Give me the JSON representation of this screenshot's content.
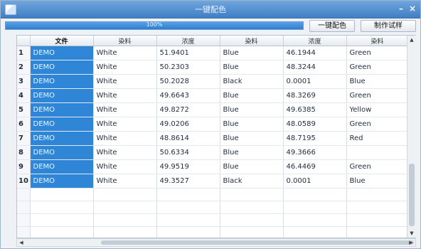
{
  "window": {
    "title": "一键配色",
    "min_glyph": "–",
    "close_glyph": "×"
  },
  "progress": {
    "value": 1.0,
    "text": "100%"
  },
  "toolbar": {
    "match_label": "一键配色",
    "sample_label": "制作试样"
  },
  "table": {
    "headers": [
      "文件",
      "染料",
      "浓度",
      "染料",
      "浓度",
      "染料"
    ],
    "rows": [
      {
        "num": "1",
        "cells": [
          "DEMO",
          "White",
          "51.9401",
          "Blue",
          "46.1944",
          "Green"
        ]
      },
      {
        "num": "2",
        "cells": [
          "DEMO",
          "White",
          "50.2303",
          "Blue",
          "48.3244",
          "Green"
        ]
      },
      {
        "num": "3",
        "cells": [
          "DEMO",
          "White",
          "50.2028",
          "Black",
          "0.0001",
          "Blue"
        ]
      },
      {
        "num": "4",
        "cells": [
          "DEMO",
          "White",
          "49.6643",
          "Blue",
          "48.3269",
          "Green"
        ]
      },
      {
        "num": "5",
        "cells": [
          "DEMO",
          "White",
          "49.8272",
          "Blue",
          "49.6385",
          "Yellow"
        ]
      },
      {
        "num": "6",
        "cells": [
          "DEMO",
          "White",
          "49.0206",
          "Blue",
          "48.0589",
          "Green"
        ]
      },
      {
        "num": "7",
        "cells": [
          "DEMO",
          "White",
          "48.8614",
          "Blue",
          "48.7195",
          "Red"
        ]
      },
      {
        "num": "8",
        "cells": [
          "DEMO",
          "White",
          "50.6334",
          "Blue",
          "49.3666",
          ""
        ]
      },
      {
        "num": "9",
        "cells": [
          "DEMO",
          "White",
          "49.9519",
          "Blue",
          "46.4469",
          "Green"
        ]
      },
      {
        "num": "10",
        "cells": [
          "DEMO",
          "White",
          "49.3527",
          "Black",
          "0.0001",
          "Blue"
        ]
      }
    ]
  },
  "scroll": {
    "up": "▲",
    "down": "▼",
    "left": "◀",
    "right": "▶"
  },
  "colors": {
    "titlebar": "#4f8fd0",
    "progress_fill": "#2d7fd0",
    "selection": "#2f86d6"
  }
}
